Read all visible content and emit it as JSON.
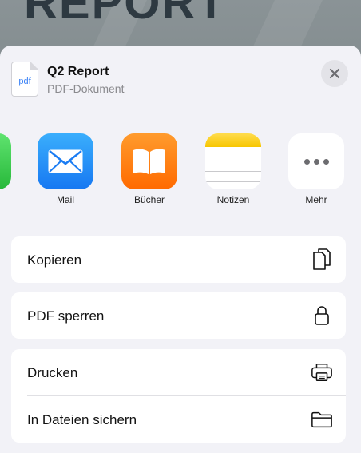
{
  "background": {
    "title_text": "REPORT"
  },
  "sheet": {
    "file": {
      "icon_label": "pdf",
      "title": "Q2 Report",
      "subtitle": "PDF-Dokument"
    },
    "close_icon": "close-icon",
    "apps": [
      {
        "name": "Mail",
        "icon": "mail-icon"
      },
      {
        "name": "Bücher",
        "icon": "books-icon"
      },
      {
        "name": "Notizen",
        "icon": "notes-icon"
      },
      {
        "name": "Mehr",
        "icon": "more-icon"
      }
    ],
    "actions": {
      "copy": {
        "label": "Kopieren",
        "icon": "copy-icon"
      },
      "lock_pdf": {
        "label": "PDF sperren",
        "icon": "lock-icon"
      },
      "print": {
        "label": "Drucken",
        "icon": "printer-icon"
      },
      "save_files": {
        "label": "In Dateien sichern",
        "icon": "folder-icon"
      }
    }
  },
  "colors": {
    "sheet_background": "#f2f2f7",
    "row_background": "#ffffff",
    "mail_blue": "#1778f2",
    "books_orange": "#ff6a00",
    "notes_yellow": "#f7c600"
  }
}
